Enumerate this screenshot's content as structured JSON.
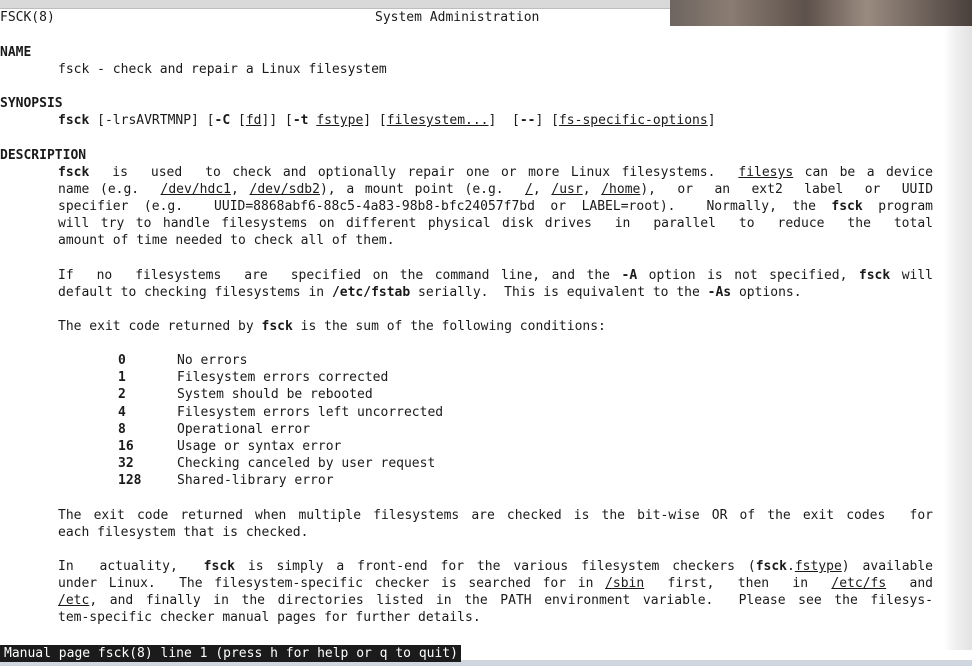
{
  "header": {
    "left": "FSCK(8)",
    "center": "System Administration"
  },
  "sections": {
    "name_heading": "NAME",
    "name_text": "fsck - check and repair a Linux filesystem",
    "synopsis_heading": "SYNOPSIS",
    "synopsis": {
      "cmd": "fsck",
      "opts1": " [-lrsAVRTMNP] [",
      "opt_C": "-C",
      "space1": " [",
      "fd": "fd",
      "close1": "]] [",
      "opt_t": "-t",
      "space2": " ",
      "fstype": "fstype",
      "close2": "] [",
      "filesystem": "filesystem...",
      "close3": "]  [",
      "dashdash": "--",
      "close4": "] [",
      "fs_specific": "fs-specific-options",
      "close5": "]"
    },
    "description_heading": "DESCRIPTION",
    "desc_p1": {
      "l1_fsck": "fsck",
      "l1_mid": "  is  used  to check and optionally repair one or more Linux filesystems.  ",
      "l1_filesys": "filesys",
      "l1_end": " can be a device",
      "l2_a": "name (e.g.  ",
      "l2_hdc1": "/dev/hdc1",
      "l2_b": ", ",
      "l2_sdb2": "/dev/sdb2",
      "l2_c": "), a mount point (e.g.  ",
      "l2_root": "/",
      "l2_d": ", ",
      "l2_usr": "/usr",
      "l2_e": ", ",
      "l2_home": "/home",
      "l2_f": "),  or  an  ext2  label  or  UUID",
      "l3_a": "specifier (e.g.  UUID=8868abf6-88c5-4a83-98b8-bfc24057f7bd or LABEL=root).  Normally, the ",
      "l3_fsck": "fsck",
      "l3_b": " program",
      "l4": "will try to handle filesystems on different physical disk drives  in  parallel  to  reduce  the  total",
      "l5": "amount of time needed to check all of them."
    },
    "desc_p2": {
      "l1_a": "If  no  filesystems  are  specified on the command line, and the ",
      "l1_A": "-A",
      "l1_b": " option is not specified, ",
      "l1_fsck": "fsck",
      "l1_c": " will",
      "l2_a": "default to checking filesystems in ",
      "l2_fstab": "/etc/fstab",
      "l2_b": " serially.  This is equivalent to the ",
      "l2_As": "-As",
      "l2_c": " options."
    },
    "desc_p3": {
      "a": "The exit code returned by ",
      "fsck": "fsck",
      "b": " is the sum of the following conditions:"
    },
    "exit_codes": [
      {
        "code": "0",
        "desc": "No errors"
      },
      {
        "code": "1",
        "desc": "Filesystem errors corrected"
      },
      {
        "code": "2",
        "desc": "System should be rebooted"
      },
      {
        "code": "4",
        "desc": "Filesystem errors left uncorrected"
      },
      {
        "code": "8",
        "desc": "Operational error"
      },
      {
        "code": "16",
        "desc": "Usage or syntax error"
      },
      {
        "code": "32",
        "desc": "Checking canceled by user request"
      },
      {
        "code": "128",
        "desc": "Shared-library error"
      }
    ],
    "desc_p4": {
      "l1": "The exit code returned when multiple filesystems are checked is the bit-wise OR of the exit codes  for",
      "l2": "each filesystem that is checked."
    },
    "desc_p5": {
      "l1_a": "In  actuality,  ",
      "l1_fsck": "fsck",
      "l1_b": " is simply a front-end for the various filesystem checkers (",
      "l1_fsck2": "fsck",
      "l1_dot": ".",
      "l1_fstype": "fstype",
      "l1_c": ") available",
      "l2_a": "under Linux.  The filesystem-specific checker is searched for in ",
      "l2_sbin": "/sbin",
      "l2_b": "  first,  then  in  ",
      "l2_etcfs": "/etc/fs",
      "l2_c": "  and",
      "l3_etc": "/etc",
      "l3_a": ", and finally in the directories listed in the PATH environment variable.  Please see the filesys-",
      "l4": "tem-specific checker manual pages for further details."
    }
  },
  "status_bar": "Manual page fsck(8) line 1 (press h for help or q to quit)"
}
